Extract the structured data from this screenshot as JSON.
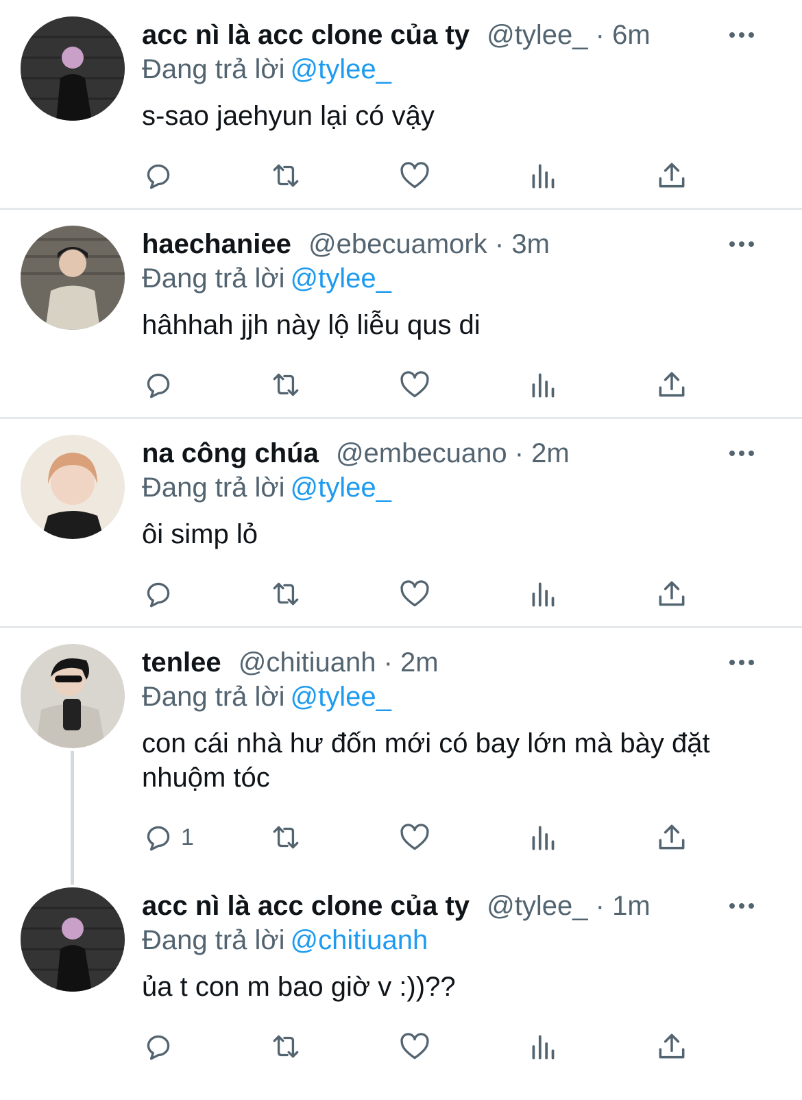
{
  "reply_prefix": "Đang trả lời",
  "tweets": [
    {
      "name": "acc nì là acc clone của ty",
      "handle": "@tylee_",
      "time": "6m",
      "reply_to": "@tylee_",
      "text": "s-sao jaehyun lại có vậy",
      "reply_count": ""
    },
    {
      "name": "haechaniee",
      "handle": "@ebecuamork",
      "time": "3m",
      "reply_to": "@tylee_",
      "text": "hâhhah jjh này lộ liễu qus di",
      "reply_count": ""
    },
    {
      "name": "na công chúa",
      "handle": "@embecuano",
      "time": "2m",
      "reply_to": "@tylee_",
      "text": "ôi simp lỏ",
      "reply_count": ""
    },
    {
      "name": "tenlee",
      "handle": "@chitiuanh",
      "time": "2m",
      "reply_to": "@tylee_",
      "text": "con cái nhà hư đốn mới có bay lớn mà bày đặt nhuộm tóc",
      "reply_count": "1"
    },
    {
      "name": "acc nì là acc clone của ty",
      "handle": "@tylee_",
      "time": "1m",
      "reply_to": "@chitiuanh",
      "text": "ủa t con m bao giờ v :))??",
      "reply_count": ""
    }
  ],
  "meta_separator": "·",
  "icons": [
    "reply-icon",
    "retweet-icon",
    "like-icon",
    "views-icon",
    "share-icon",
    "more-icon"
  ],
  "colors": {
    "accent": "#1d9bf0",
    "secondary": "#536471",
    "text": "#0f1419"
  }
}
